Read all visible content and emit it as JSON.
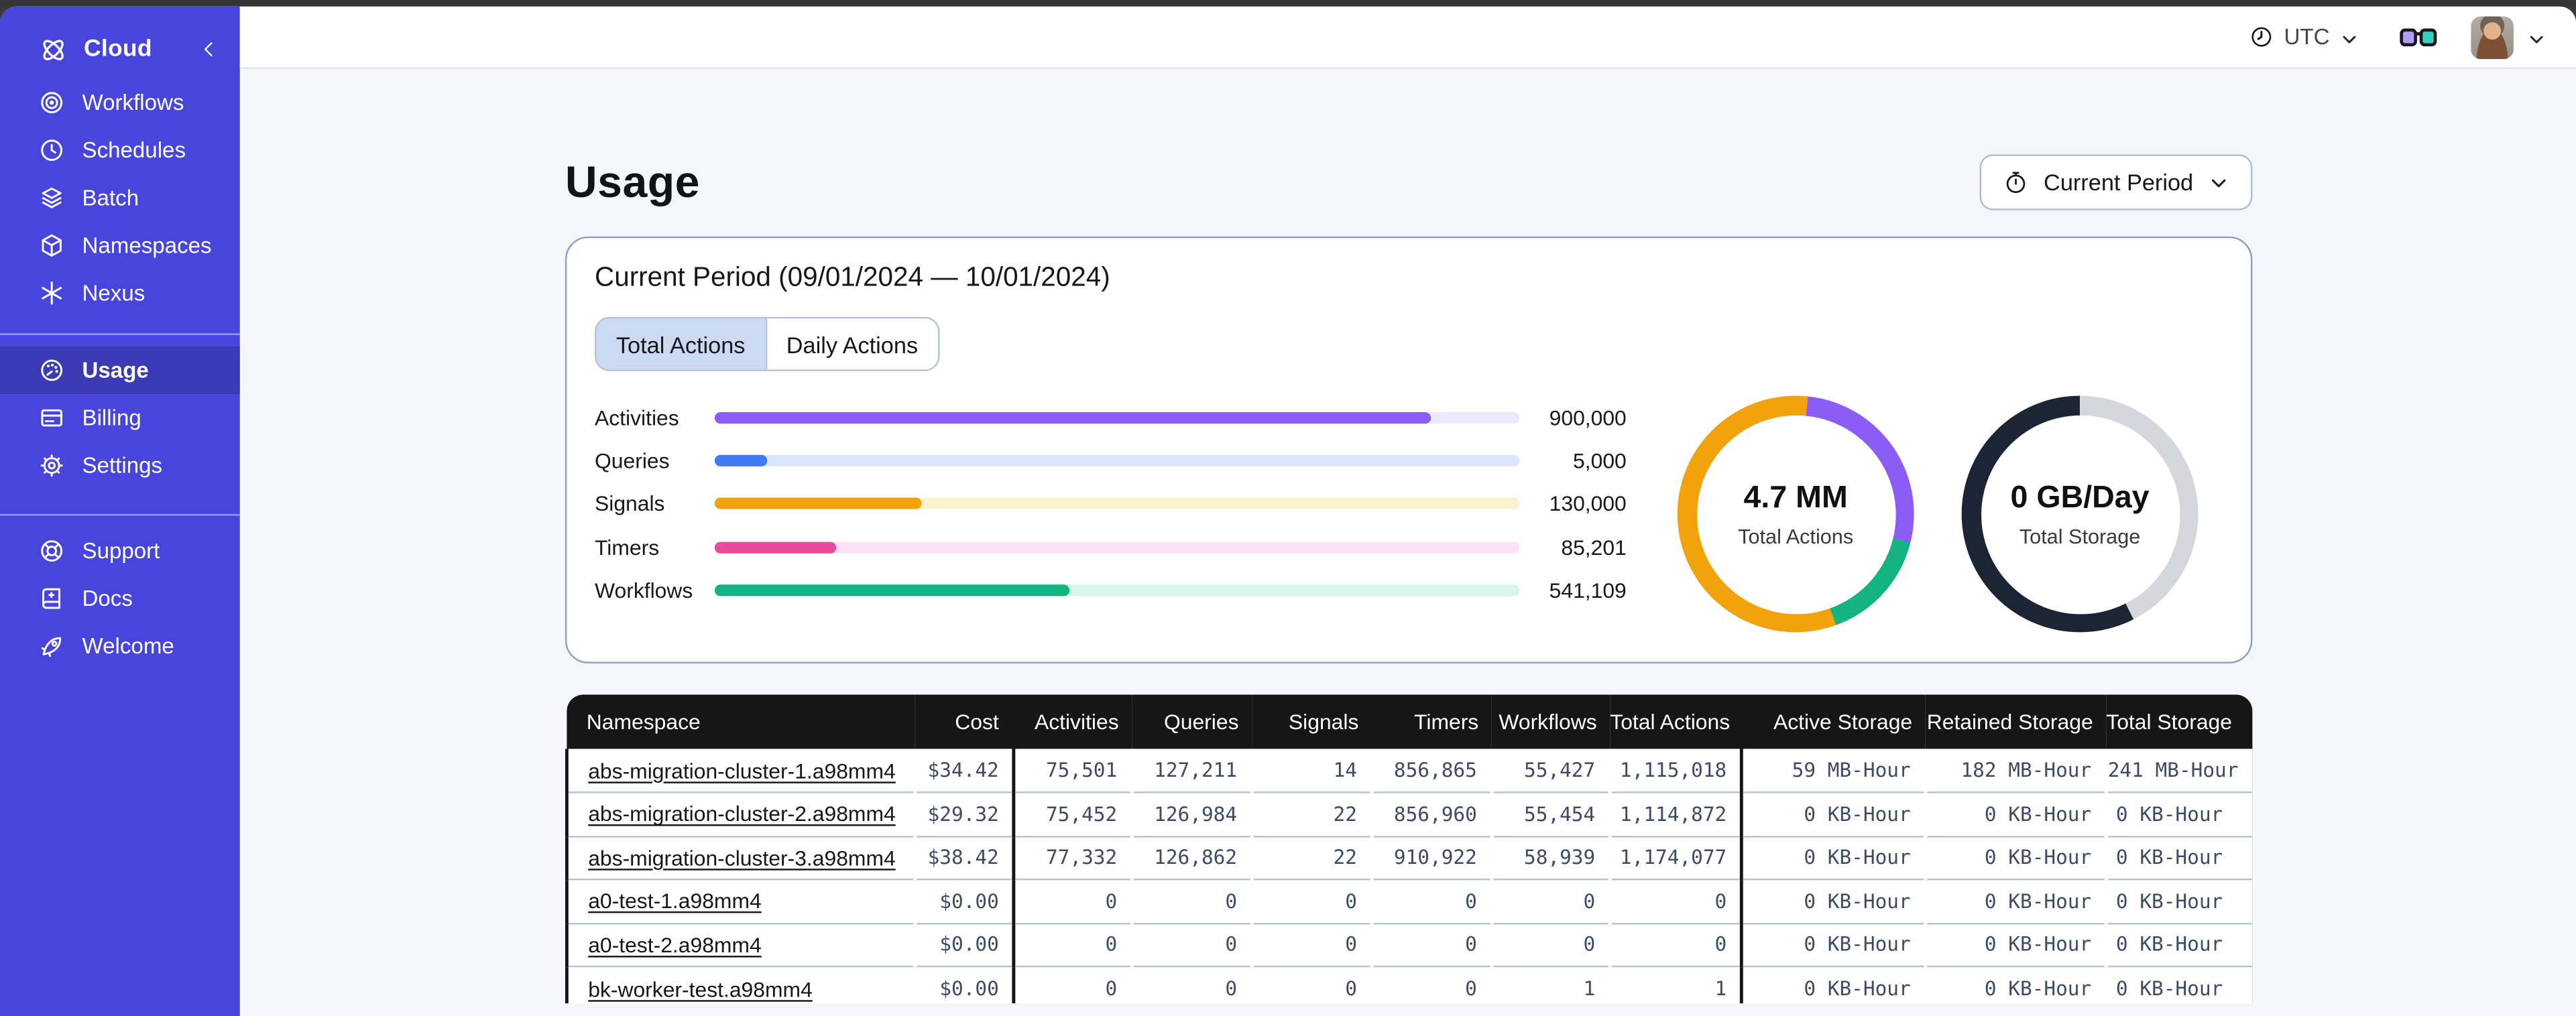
{
  "chrome": {
    "timezone": "UTC"
  },
  "sidebar": {
    "brand": "Cloud",
    "nav": [
      {
        "label": "Workflows",
        "icon": "workflows-icon"
      },
      {
        "label": "Schedules",
        "icon": "schedules-icon"
      },
      {
        "label": "Batch",
        "icon": "batch-icon"
      },
      {
        "label": "Namespaces",
        "icon": "namespaces-icon"
      },
      {
        "label": "Nexus",
        "icon": "nexus-icon"
      }
    ],
    "account_nav": [
      {
        "label": "Usage",
        "icon": "usage-icon",
        "active": true
      },
      {
        "label": "Billing",
        "icon": "billing-icon"
      },
      {
        "label": "Settings",
        "icon": "settings-icon"
      }
    ],
    "footer_nav": [
      {
        "label": "Support",
        "icon": "support-icon"
      },
      {
        "label": "Docs",
        "icon": "docs-icon"
      },
      {
        "label": "Welcome",
        "icon": "welcome-icon"
      }
    ]
  },
  "page": {
    "title": "Usage",
    "period_selector": "Current Period"
  },
  "usage_card": {
    "title": "Current Period (09/01/2024 — 10/01/2024)",
    "tabs": [
      "Total Actions",
      "Daily Actions"
    ],
    "active_tab": "Total Actions"
  },
  "chart_data": [
    {
      "type": "bar",
      "orientation": "horizontal",
      "categories": [
        "Activities",
        "Queries",
        "Signals",
        "Timers",
        "Workflows"
      ],
      "values": [
        900000,
        5000,
        130000,
        85201,
        541109
      ],
      "display_values": [
        "900,000",
        "5,000",
        "130,000",
        "85,201",
        "541,109"
      ],
      "fill_fractions": [
        0.89,
        0.065,
        0.258,
        0.152,
        0.44
      ],
      "colors": [
        "#8b5cf6",
        "#3f7bf5",
        "#f2a30b",
        "#e84b9c",
        "#14b482"
      ],
      "track_colors": [
        "#ede9fd",
        "#dbe7fc",
        "#fcf2d2",
        "#fce3f3",
        "#d9f6ea"
      ],
      "grid": false,
      "legend": false
    },
    {
      "type": "pie",
      "title": "Total Actions donut",
      "center_value": "4.7 MM",
      "center_label": "Total Actions",
      "segments": [
        {
          "name": "orange-cap",
          "color": "#f2a30b",
          "start_deg": 0,
          "end_deg": 6
        },
        {
          "name": "activities-purple",
          "color": "#8b5cf6",
          "start_deg": 6,
          "end_deg": 104
        },
        {
          "name": "workflows-green",
          "color": "#14b482",
          "start_deg": 104,
          "end_deg": 160
        },
        {
          "name": "other-orange",
          "color": "#f2a30b",
          "start_deg": 160,
          "end_deg": 360
        }
      ]
    },
    {
      "type": "pie",
      "title": "Total Storage donut",
      "center_value": "0 GB/Day",
      "center_label": "Total Storage",
      "segments": [
        {
          "name": "gray",
          "color": "#d5d7dd",
          "start_deg": 0,
          "end_deg": 153
        },
        {
          "name": "dark",
          "color": "#1c2534",
          "start_deg": 153,
          "end_deg": 360
        }
      ]
    }
  ],
  "table": {
    "columns": [
      "Namespace",
      "Cost",
      "Activities",
      "Queries",
      "Signals",
      "Timers",
      "Workflows",
      "Total Actions",
      "Active Storage",
      "Retained Storage",
      "Total Storage"
    ],
    "rows": [
      [
        "abs-migration-cluster-1.a98mm4",
        "$34.42",
        "75,501",
        "127,211",
        "14",
        "856,865",
        "55,427",
        "1,115,018",
        "59 MB-Hour",
        "182 MB-Hour",
        "241 MB-Hour"
      ],
      [
        "abs-migration-cluster-2.a98mm4",
        "$29.32",
        "75,452",
        "126,984",
        "22",
        "856,960",
        "55,454",
        "1,114,872",
        "0 KB-Hour",
        "0 KB-Hour",
        "0 KB-Hour"
      ],
      [
        "abs-migration-cluster-3.a98mm4",
        "$38.42",
        "77,332",
        "126,862",
        "22",
        "910,922",
        "58,939",
        "1,174,077",
        "0 KB-Hour",
        "0 KB-Hour",
        "0 KB-Hour"
      ],
      [
        "a0-test-1.a98mm4",
        "$0.00",
        "0",
        "0",
        "0",
        "0",
        "0",
        "0",
        "0 KB-Hour",
        "0 KB-Hour",
        "0 KB-Hour"
      ],
      [
        "a0-test-2.a98mm4",
        "$0.00",
        "0",
        "0",
        "0",
        "0",
        "0",
        "0",
        "0 KB-Hour",
        "0 KB-Hour",
        "0 KB-Hour"
      ],
      [
        "bk-worker-test.a98mm4",
        "$0.00",
        "0",
        "0",
        "0",
        "0",
        "1",
        "1",
        "0 KB-Hour",
        "0 KB-Hour",
        "0 KB-Hour"
      ]
    ]
  }
}
